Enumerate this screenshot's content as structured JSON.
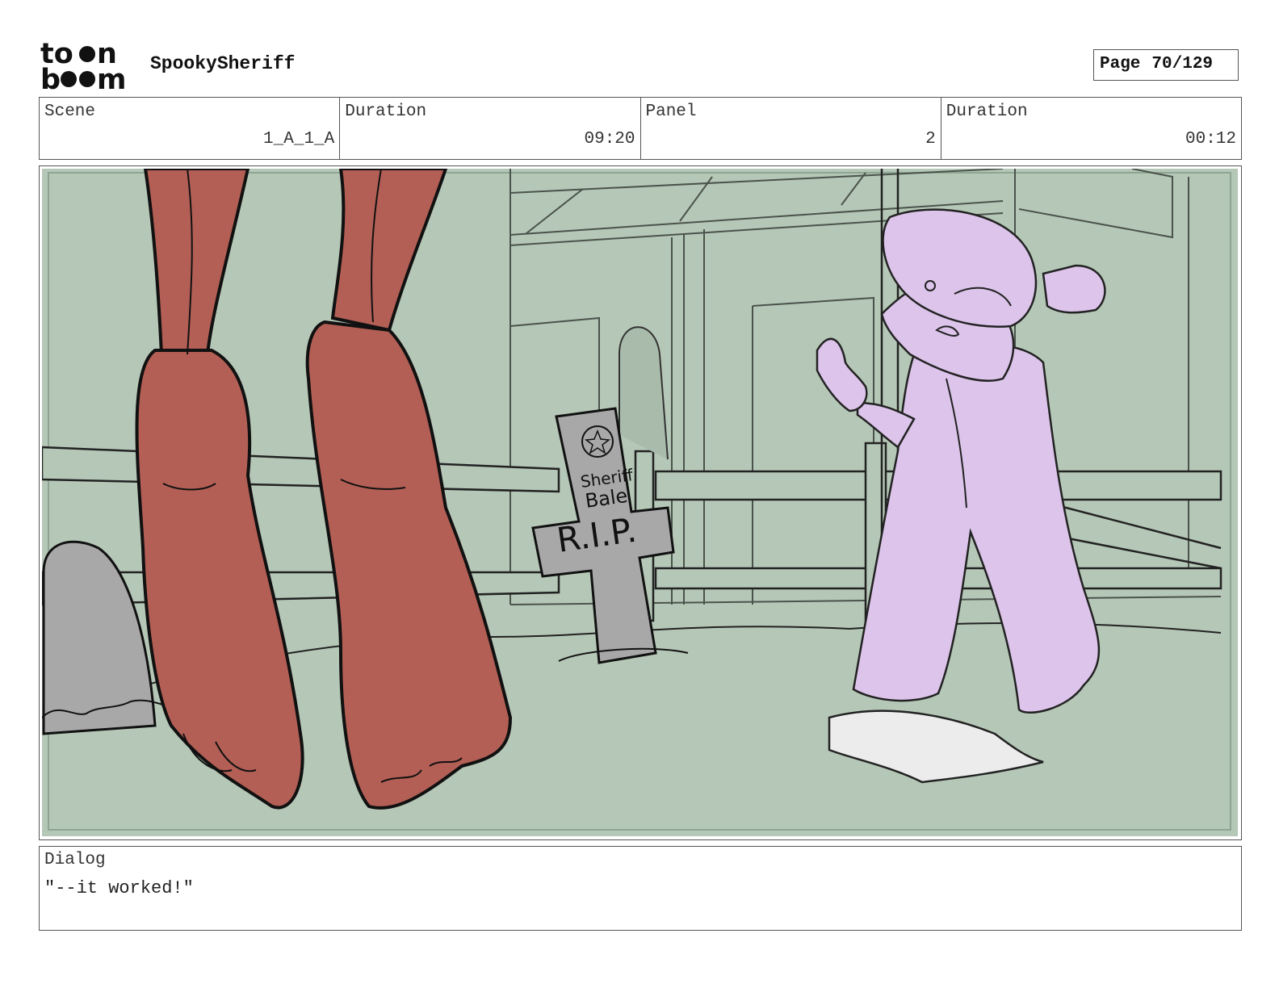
{
  "header": {
    "logo_icon": "toonboom-logo",
    "project": "SpookySheriff",
    "page_label": "Page",
    "page_number": "70/129"
  },
  "info": {
    "scene_label": "Scene",
    "scene_value": "1_A_1_A",
    "scene_duration_label": "Duration",
    "scene_duration_value": "09:20",
    "panel_label": "Panel",
    "panel_value": "2",
    "panel_duration_label": "Duration",
    "panel_duration_value": "00:12"
  },
  "panel": {
    "tombstone_text_1": "Sheriff",
    "tombstone_text_2": "Bale",
    "tombstone_text_3": "R.I.P.",
    "colors": {
      "background": "#b5c7b7",
      "skin": "#b35f55",
      "character": "#dcc4ea",
      "stone": "#a8a8a8"
    }
  },
  "dialog": {
    "label": "Dialog",
    "text": "\"--it worked!\""
  }
}
